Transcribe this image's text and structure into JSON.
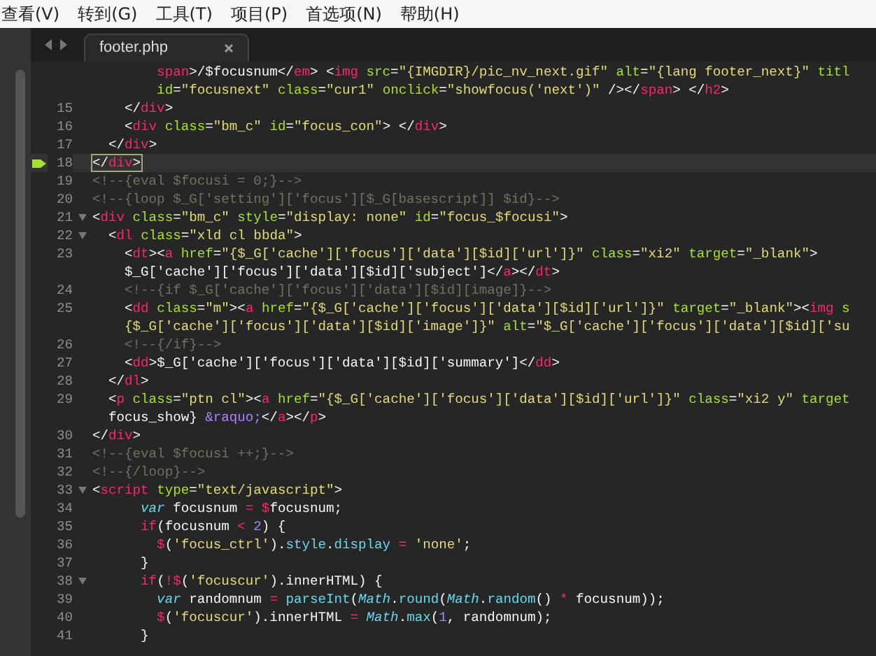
{
  "menu": [
    "查看(V)",
    "转到(G)",
    "工具(T)",
    "项目(P)",
    "首选项(N)",
    "帮助(H)"
  ],
  "tabs": [
    {
      "label": "footer.php",
      "selected": true
    }
  ],
  "lines": [
    {
      "fold": false,
      "current": false,
      "bookmark": false,
      "tokens": [
        {
          "kind": "tag",
          "text": "        span"
        },
        {
          "kind": "txt",
          "text": ">/$focusnum</"
        },
        {
          "kind": "tag",
          "text": "em"
        },
        {
          "kind": "txt",
          "text": "> <"
        },
        {
          "kind": "tag",
          "text": "img "
        },
        {
          "kind": "attr",
          "text": "src"
        },
        {
          "kind": "txt",
          "text": "="
        },
        {
          "kind": "str",
          "text": "\"{IMGDIR}/pic_nv_next.gif\" "
        },
        {
          "kind": "attr",
          "text": "alt"
        },
        {
          "kind": "txt",
          "text": "="
        },
        {
          "kind": "str",
          "text": "\"{lang footer_next}\" "
        },
        {
          "kind": "attr",
          "text": "titl"
        }
      ]
    },
    {
      "fold": false,
      "current": false,
      "bookmark": false,
      "tokens": [
        {
          "kind": "attr",
          "text": "        id"
        },
        {
          "kind": "txt",
          "text": "="
        },
        {
          "kind": "str",
          "text": "\"focusnext\" "
        },
        {
          "kind": "attr",
          "text": "class"
        },
        {
          "kind": "txt",
          "text": "="
        },
        {
          "kind": "str",
          "text": "\"cur1\" "
        },
        {
          "kind": "attr",
          "text": "onclick"
        },
        {
          "kind": "txt",
          "text": "="
        },
        {
          "kind": "str",
          "text": "\"showfocus('next')\""
        },
        {
          "kind": "txt",
          "text": " /></"
        },
        {
          "kind": "tag",
          "text": "span"
        },
        {
          "kind": "txt",
          "text": "> </"
        },
        {
          "kind": "tag",
          "text": "h2"
        },
        {
          "kind": "txt",
          "text": ">"
        }
      ]
    },
    {
      "number": "15",
      "fold": false,
      "current": false,
      "bookmark": false,
      "tokens": [
        {
          "kind": "txt",
          "text": "    </"
        },
        {
          "kind": "tag",
          "text": "div"
        },
        {
          "kind": "txt",
          "text": ">"
        }
      ]
    },
    {
      "number": "16",
      "fold": false,
      "current": false,
      "bookmark": false,
      "tokens": [
        {
          "kind": "txt",
          "text": "    <"
        },
        {
          "kind": "tag",
          "text": "div "
        },
        {
          "kind": "attr",
          "text": "class"
        },
        {
          "kind": "txt",
          "text": "="
        },
        {
          "kind": "str",
          "text": "\"bm_c\" "
        },
        {
          "kind": "attr",
          "text": "id"
        },
        {
          "kind": "txt",
          "text": "="
        },
        {
          "kind": "str",
          "text": "\"focus_con\""
        },
        {
          "kind": "txt",
          "text": "> </"
        },
        {
          "kind": "tag",
          "text": "div"
        },
        {
          "kind": "txt",
          "text": ">"
        }
      ]
    },
    {
      "number": "17",
      "fold": false,
      "current": false,
      "bookmark": false,
      "tokens": [
        {
          "kind": "txt",
          "text": "  </"
        },
        {
          "kind": "tag",
          "text": "div"
        },
        {
          "kind": "txt",
          "text": ">"
        }
      ]
    },
    {
      "number": "18",
      "fold": false,
      "current": true,
      "bookmark": true,
      "tokens": [
        {
          "kind": "txt",
          "text": "</"
        },
        {
          "kind": "tag",
          "text": "div"
        },
        {
          "kind": "txt",
          "text": ">"
        }
      ]
    },
    {
      "number": "19",
      "fold": false,
      "current": false,
      "bookmark": false,
      "tokens": [
        {
          "kind": "com",
          "text": "<!--{eval $focusi = 0;}-->"
        }
      ]
    },
    {
      "number": "20",
      "fold": false,
      "current": false,
      "bookmark": false,
      "tokens": [
        {
          "kind": "com",
          "text": "<!--{loop $_G['setting']['focus'][$_G[basescript]] $id}-->"
        }
      ]
    },
    {
      "number": "21",
      "fold": true,
      "current": false,
      "bookmark": false,
      "tokens": [
        {
          "kind": "txt",
          "text": "<"
        },
        {
          "kind": "tag",
          "text": "div "
        },
        {
          "kind": "attr",
          "text": "class"
        },
        {
          "kind": "txt",
          "text": "="
        },
        {
          "kind": "str",
          "text": "\"bm_c\" "
        },
        {
          "kind": "attr",
          "text": "style"
        },
        {
          "kind": "txt",
          "text": "="
        },
        {
          "kind": "str",
          "text": "\"display: none\" "
        },
        {
          "kind": "attr",
          "text": "id"
        },
        {
          "kind": "txt",
          "text": "="
        },
        {
          "kind": "str",
          "text": "\"focus_$focusi\""
        },
        {
          "kind": "txt",
          "text": ">"
        }
      ]
    },
    {
      "number": "22",
      "fold": true,
      "current": false,
      "bookmark": false,
      "tokens": [
        {
          "kind": "txt",
          "text": "  <"
        },
        {
          "kind": "tag",
          "text": "dl "
        },
        {
          "kind": "attr",
          "text": "class"
        },
        {
          "kind": "txt",
          "text": "="
        },
        {
          "kind": "str",
          "text": "\"xld cl bbda\""
        },
        {
          "kind": "txt",
          "text": ">"
        }
      ]
    },
    {
      "number": "23",
      "fold": false,
      "current": false,
      "bookmark": false,
      "tokens": [
        {
          "kind": "txt",
          "text": "    <"
        },
        {
          "kind": "tag",
          "text": "dt"
        },
        {
          "kind": "txt",
          "text": "><"
        },
        {
          "kind": "tag",
          "text": "a "
        },
        {
          "kind": "attr",
          "text": "href"
        },
        {
          "kind": "txt",
          "text": "="
        },
        {
          "kind": "str",
          "text": "\"{$_G['cache']['focus']['data'][$id]['url']}\" "
        },
        {
          "kind": "attr",
          "text": "class"
        },
        {
          "kind": "txt",
          "text": "="
        },
        {
          "kind": "str",
          "text": "\"xi2\" "
        },
        {
          "kind": "attr",
          "text": "target"
        },
        {
          "kind": "txt",
          "text": "="
        },
        {
          "kind": "str",
          "text": "\"_blank\""
        },
        {
          "kind": "txt",
          "text": ">"
        }
      ]
    },
    {
      "fold": false,
      "current": false,
      "bookmark": false,
      "tokens": [
        {
          "kind": "txt",
          "text": "    $_G['cache']['focus']['data'][$id]['subject']</"
        },
        {
          "kind": "tag",
          "text": "a"
        },
        {
          "kind": "txt",
          "text": "></"
        },
        {
          "kind": "tag",
          "text": "dt"
        },
        {
          "kind": "txt",
          "text": ">"
        }
      ]
    },
    {
      "number": "24",
      "fold": false,
      "current": false,
      "bookmark": false,
      "tokens": [
        {
          "kind": "com",
          "text": "    <!--{if $_G['cache']['focus']['data'][$id][image]}-->"
        }
      ]
    },
    {
      "number": "25",
      "fold": false,
      "current": false,
      "bookmark": false,
      "tokens": [
        {
          "kind": "txt",
          "text": "    <"
        },
        {
          "kind": "tag",
          "text": "dd "
        },
        {
          "kind": "attr",
          "text": "class"
        },
        {
          "kind": "txt",
          "text": "="
        },
        {
          "kind": "str",
          "text": "\"m\""
        },
        {
          "kind": "txt",
          "text": "><"
        },
        {
          "kind": "tag",
          "text": "a "
        },
        {
          "kind": "attr",
          "text": "href"
        },
        {
          "kind": "txt",
          "text": "="
        },
        {
          "kind": "str",
          "text": "\"{$_G['cache']['focus']['data'][$id]['url']}\" "
        },
        {
          "kind": "attr",
          "text": "target"
        },
        {
          "kind": "txt",
          "text": "="
        },
        {
          "kind": "str",
          "text": "\"_blank\""
        },
        {
          "kind": "txt",
          "text": "><"
        },
        {
          "kind": "tag",
          "text": "img "
        },
        {
          "kind": "attr",
          "text": "s"
        }
      ]
    },
    {
      "fold": false,
      "current": false,
      "bookmark": false,
      "tokens": [
        {
          "kind": "str",
          "text": "    {$_G['cache']['focus']['data'][$id]['image']}\" "
        },
        {
          "kind": "attr",
          "text": "alt"
        },
        {
          "kind": "txt",
          "text": "="
        },
        {
          "kind": "str",
          "text": "\"$_G['cache']['focus']['data'][$id]['su"
        }
      ]
    },
    {
      "number": "26",
      "fold": false,
      "current": false,
      "bookmark": false,
      "tokens": [
        {
          "kind": "com",
          "text": "    <!--{/if}-->"
        }
      ]
    },
    {
      "number": "27",
      "fold": false,
      "current": false,
      "bookmark": false,
      "tokens": [
        {
          "kind": "txt",
          "text": "    <"
        },
        {
          "kind": "tag",
          "text": "dd"
        },
        {
          "kind": "txt",
          "text": ">$_G['cache']['focus']['data'][$id]['summary']</"
        },
        {
          "kind": "tag",
          "text": "dd"
        },
        {
          "kind": "txt",
          "text": ">"
        }
      ]
    },
    {
      "number": "28",
      "fold": false,
      "current": false,
      "bookmark": false,
      "tokens": [
        {
          "kind": "txt",
          "text": "  </"
        },
        {
          "kind": "tag",
          "text": "dl"
        },
        {
          "kind": "txt",
          "text": ">"
        }
      ]
    },
    {
      "number": "29",
      "fold": false,
      "current": false,
      "bookmark": false,
      "tokens": [
        {
          "kind": "txt",
          "text": "  <"
        },
        {
          "kind": "tag",
          "text": "p "
        },
        {
          "kind": "attr",
          "text": "class"
        },
        {
          "kind": "txt",
          "text": "="
        },
        {
          "kind": "str",
          "text": "\"ptn cl\""
        },
        {
          "kind": "txt",
          "text": "><"
        },
        {
          "kind": "tag",
          "text": "a "
        },
        {
          "kind": "attr",
          "text": "href"
        },
        {
          "kind": "txt",
          "text": "="
        },
        {
          "kind": "str",
          "text": "\"{$_G['cache']['focus']['data'][$id]['url']}\" "
        },
        {
          "kind": "attr",
          "text": "class"
        },
        {
          "kind": "txt",
          "text": "="
        },
        {
          "kind": "str",
          "text": "\"xi2 y\" "
        },
        {
          "kind": "attr",
          "text": "target"
        }
      ]
    },
    {
      "fold": false,
      "current": false,
      "bookmark": false,
      "tokens": [
        {
          "kind": "txt",
          "text": "  focus_show} "
        },
        {
          "kind": "num",
          "text": "&raquo;"
        },
        {
          "kind": "txt",
          "text": "</"
        },
        {
          "kind": "tag",
          "text": "a"
        },
        {
          "kind": "txt",
          "text": "></"
        },
        {
          "kind": "tag",
          "text": "p"
        },
        {
          "kind": "txt",
          "text": ">"
        }
      ]
    },
    {
      "number": "30",
      "fold": false,
      "current": false,
      "bookmark": false,
      "tokens": [
        {
          "kind": "txt",
          "text": "</"
        },
        {
          "kind": "tag",
          "text": "div"
        },
        {
          "kind": "txt",
          "text": ">"
        }
      ]
    },
    {
      "number": "31",
      "fold": false,
      "current": false,
      "bookmark": false,
      "tokens": [
        {
          "kind": "com",
          "text": "<!--{eval $focusi ++;}-->"
        }
      ]
    },
    {
      "number": "32",
      "fold": false,
      "current": false,
      "bookmark": false,
      "tokens": [
        {
          "kind": "com",
          "text": "<!--{/loop}-->"
        }
      ]
    },
    {
      "number": "33",
      "fold": true,
      "current": false,
      "bookmark": false,
      "tokens": [
        {
          "kind": "txt",
          "text": "<"
        },
        {
          "kind": "tag",
          "text": "script "
        },
        {
          "kind": "attr",
          "text": "type"
        },
        {
          "kind": "txt",
          "text": "="
        },
        {
          "kind": "str",
          "text": "\"text/javascript\""
        },
        {
          "kind": "txt",
          "text": ">"
        }
      ]
    },
    {
      "number": "34",
      "fold": false,
      "current": false,
      "bookmark": false,
      "tokens": [
        {
          "kind": "type",
          "text": "      var"
        },
        {
          "kind": "txt",
          "text": " focusnum "
        },
        {
          "kind": "op",
          "text": "= $"
        },
        {
          "kind": "txt",
          "text": "focusnum;"
        }
      ]
    },
    {
      "number": "35",
      "fold": false,
      "current": false,
      "bookmark": false,
      "tokens": [
        {
          "kind": "op",
          "text": "      if"
        },
        {
          "kind": "txt",
          "text": "(focusnum "
        },
        {
          "kind": "op",
          "text": "< "
        },
        {
          "kind": "num",
          "text": "2"
        },
        {
          "kind": "txt",
          "text": ") {"
        }
      ]
    },
    {
      "number": "36",
      "fold": false,
      "current": false,
      "bookmark": false,
      "tokens": [
        {
          "kind": "op",
          "text": "        $"
        },
        {
          "kind": "txt",
          "text": "("
        },
        {
          "kind": "str",
          "text": "'focus_ctrl'"
        },
        {
          "kind": "txt",
          "text": ")."
        },
        {
          "kind": "fn",
          "text": "style"
        },
        {
          "kind": "txt",
          "text": "."
        },
        {
          "kind": "fn",
          "text": "display "
        },
        {
          "kind": "op",
          "text": "= "
        },
        {
          "kind": "str",
          "text": "'none'"
        },
        {
          "kind": "txt",
          "text": ";"
        }
      ]
    },
    {
      "number": "37",
      "fold": false,
      "current": false,
      "bookmark": false,
      "tokens": [
        {
          "kind": "txt",
          "text": "      }"
        }
      ]
    },
    {
      "number": "38",
      "fold": true,
      "current": false,
      "bookmark": false,
      "tokens": [
        {
          "kind": "op",
          "text": "      if"
        },
        {
          "kind": "txt",
          "text": "("
        },
        {
          "kind": "op",
          "text": "!$"
        },
        {
          "kind": "txt",
          "text": "("
        },
        {
          "kind": "str",
          "text": "'focuscur'"
        },
        {
          "kind": "txt",
          "text": ").innerHTML) {"
        }
      ]
    },
    {
      "number": "39",
      "fold": false,
      "current": false,
      "bookmark": false,
      "tokens": [
        {
          "kind": "type",
          "text": "        var"
        },
        {
          "kind": "txt",
          "text": " randomnum "
        },
        {
          "kind": "op",
          "text": "= "
        },
        {
          "kind": "fn",
          "text": "parseInt"
        },
        {
          "kind": "txt",
          "text": "("
        },
        {
          "kind": "type",
          "text": "Math"
        },
        {
          "kind": "txt",
          "text": "."
        },
        {
          "kind": "fn",
          "text": "round"
        },
        {
          "kind": "txt",
          "text": "("
        },
        {
          "kind": "type",
          "text": "Math"
        },
        {
          "kind": "txt",
          "text": "."
        },
        {
          "kind": "fn",
          "text": "random"
        },
        {
          "kind": "txt",
          "text": "() "
        },
        {
          "kind": "op",
          "text": "* "
        },
        {
          "kind": "txt",
          "text": "focusnum));"
        }
      ]
    },
    {
      "number": "40",
      "fold": false,
      "current": false,
      "bookmark": false,
      "tokens": [
        {
          "kind": "op",
          "text": "        $"
        },
        {
          "kind": "txt",
          "text": "("
        },
        {
          "kind": "str",
          "text": "'focuscur'"
        },
        {
          "kind": "txt",
          "text": ").innerHTML "
        },
        {
          "kind": "op",
          "text": "= "
        },
        {
          "kind": "type",
          "text": "Math"
        },
        {
          "kind": "txt",
          "text": "."
        },
        {
          "kind": "fn",
          "text": "max"
        },
        {
          "kind": "txt",
          "text": "("
        },
        {
          "kind": "num",
          "text": "1"
        },
        {
          "kind": "txt",
          "text": ", randomnum);"
        }
      ]
    },
    {
      "number": "41",
      "fold": false,
      "current": false,
      "bookmark": false,
      "tokens": [
        {
          "kind": "txt",
          "text": "      }"
        }
      ]
    }
  ]
}
